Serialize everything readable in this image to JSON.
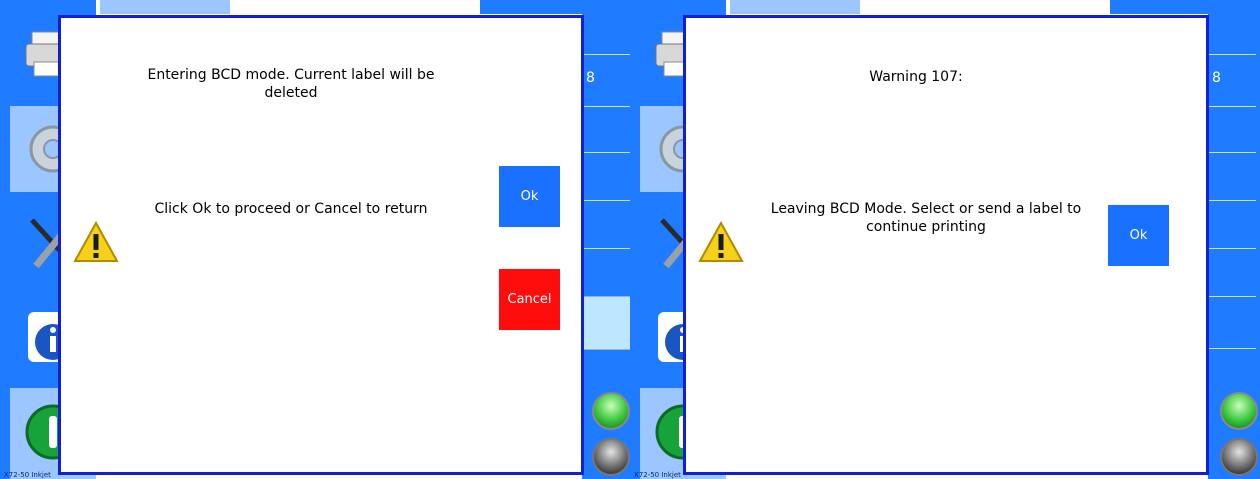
{
  "left_panel": {
    "message_line": "Entering BCD mode. Current label will be deleted",
    "instruction": "Click Ok to proceed or Cancel to return",
    "ok_label": "Ok",
    "cancel_label": "Cancel",
    "partial_number": "8",
    "footer": "X72-50 Inkjet"
  },
  "right_panel": {
    "warning_title": "Warning 107:",
    "message": "Leaving BCD Mode. Select or send a label to continue printing",
    "ok_label": "Ok",
    "partial_number": "8",
    "footer": "X72-50 Inkjet"
  },
  "sidebar_icons": [
    "printer-icon",
    "gear-icon",
    "tools-icon",
    "info-icon",
    "power-icon"
  ],
  "colors": {
    "app_blue": "#1f7bff",
    "dialog_border": "#1020d8",
    "ok_button": "#1a70ff",
    "cancel_button": "#ff0d0d"
  }
}
